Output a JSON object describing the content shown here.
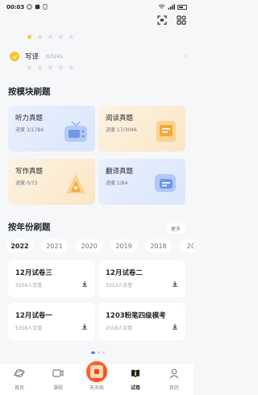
{
  "status_bar": {
    "time": "00:03"
  },
  "writing": {
    "label": "写译",
    "progress": "0/3241"
  },
  "module_section": {
    "title": "按模块刷题"
  },
  "modules": [
    {
      "title": "听力真题",
      "progress": "进度 3/1784"
    },
    {
      "title": "阅读真题",
      "progress": "进度 17/3046"
    },
    {
      "title": "写作真题",
      "progress": "进度 0/73"
    },
    {
      "title": "翻译真题",
      "progress": "进度 1/84"
    }
  ],
  "year_section": {
    "title": "按年份刷题",
    "more_label": "更多"
  },
  "years": [
    "2022",
    "2021",
    "2020",
    "2019",
    "2018",
    "201"
  ],
  "papers": [
    {
      "title": "12月试卷三",
      "sub": "3506人交卷"
    },
    {
      "title": "12月试卷二",
      "sub": "3213人交卷"
    },
    {
      "title": "12月试卷一",
      "sub": "5358人交卷"
    },
    {
      "title": "1203粉笔四级模考",
      "sub": "2518人交卷"
    }
  ],
  "tabbar": {
    "items": [
      {
        "label": "首页",
        "icon": "planet-icon"
      },
      {
        "label": "课程",
        "icon": "video-icon"
      },
      {
        "label": "天天练",
        "icon": "daily-practice-icon"
      },
      {
        "label": "试卷",
        "icon": "book-icon"
      },
      {
        "label": "我的",
        "icon": "person-icon"
      }
    ],
    "active_index": 3
  },
  "colors": {
    "accent": "#4a7ff5",
    "star": "#f7c52c",
    "orange_badge": "#f24a12"
  }
}
